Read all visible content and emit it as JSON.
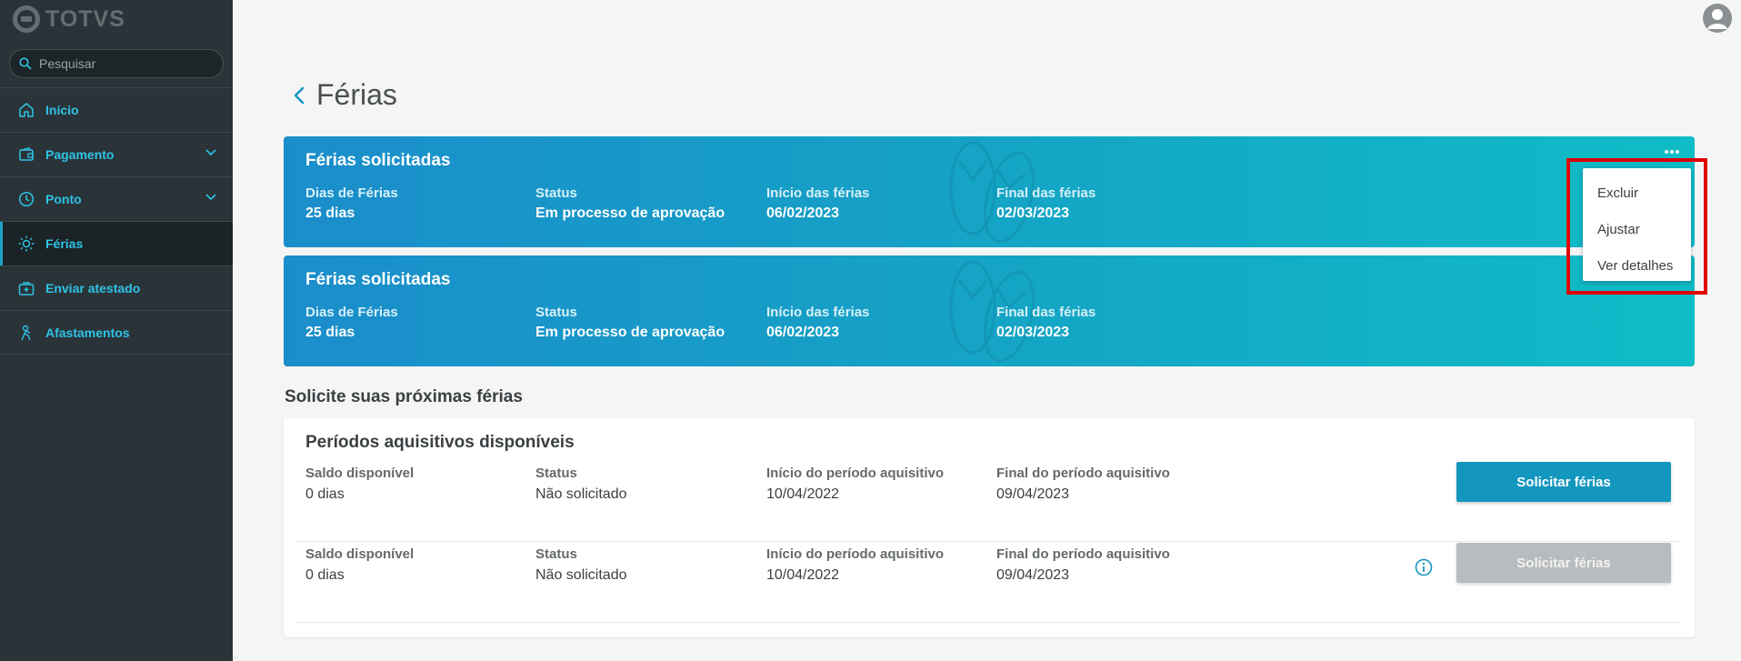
{
  "app": {
    "logo_text": "TOTVS"
  },
  "search": {
    "placeholder": "Pesquisar"
  },
  "sidebar": {
    "items": [
      {
        "label": "Início",
        "icon": "home-icon"
      },
      {
        "label": "Pagamento",
        "icon": "wallet-icon"
      },
      {
        "label": "Ponto",
        "icon": "clock-icon"
      },
      {
        "label": "Férias",
        "icon": "sun-icon"
      },
      {
        "label": "Enviar atestado",
        "icon": "medical-kit-icon"
      },
      {
        "label": "Afastamentos",
        "icon": "person-walk-icon"
      }
    ]
  },
  "page": {
    "title": "Férias"
  },
  "vacation_cards": [
    {
      "title": "Férias solicitadas",
      "dias_label": "Dias de Férias",
      "dias_value": "25 dias",
      "status_label": "Status",
      "status_value": "Em processo de aprovação",
      "inicio_label": "Início das férias",
      "inicio_value": "06/02/2023",
      "final_label": "Final das férias",
      "final_value": "02/03/2023"
    },
    {
      "title": "Férias solicitadas",
      "dias_label": "Dias de Férias",
      "dias_value": "25 dias",
      "status_label": "Status",
      "status_value": "Em processo de aprovação",
      "inicio_label": "Início das férias",
      "inicio_value": "06/02/2023",
      "final_label": "Final das férias",
      "final_value": "02/03/2023"
    }
  ],
  "context_menu": {
    "items": [
      "Excluir",
      "Ajustar",
      "Ver detalhes"
    ]
  },
  "section": {
    "title": "Solicite suas próximas férias"
  },
  "periods": {
    "title": "Períodos aquisitivos disponíveis",
    "rows": [
      {
        "saldo_label": "Saldo disponível",
        "saldo_value": "0 dias",
        "status_label": "Status",
        "status_value": "Não solicitado",
        "inicio_label": "Início do período aquisitivo",
        "inicio_value": "10/04/2022",
        "final_label": "Final do período aquisitivo",
        "final_value": "09/04/2023",
        "button_label": "Solicitar férias"
      },
      {
        "saldo_label": "Saldo disponível",
        "saldo_value": "0 dias",
        "status_label": "Status",
        "status_value": "Não solicitado",
        "inicio_label": "Início do período aquisitivo",
        "inicio_value": "10/04/2022",
        "final_label": "Final do período aquisitivo",
        "final_value": "09/04/2023",
        "button_label": "Solicitar férias"
      }
    ]
  },
  "colors": {
    "accent": "#1497bf",
    "sidebar_bg": "#2a3438",
    "highlight": "#e00000"
  }
}
